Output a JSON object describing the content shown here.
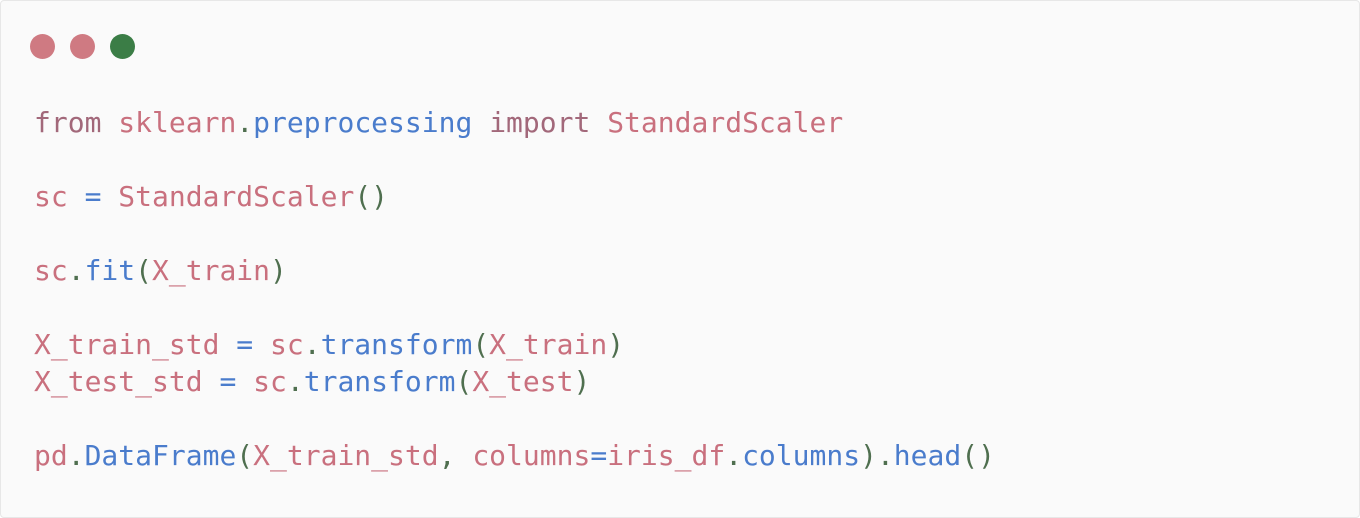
{
  "window": {
    "title_dots": [
      {
        "name": "close-dot",
        "color": "#cf7a82"
      },
      {
        "name": "minimize-dot",
        "color": "#cf7a82"
      },
      {
        "name": "maximize-dot",
        "color": "#3b7d46"
      }
    ]
  },
  "colors": {
    "keyword": "#a2687a",
    "identifier": "#c9707e",
    "attribute": "#4a7ccc",
    "punctuation": "#4f6f4f",
    "background": "#fafafa"
  },
  "code": {
    "lines": [
      [
        {
          "t": "from",
          "k": "kw"
        },
        {
          "t": " ",
          "k": "ws"
        },
        {
          "t": "sklearn",
          "k": "id"
        },
        {
          "t": ".",
          "k": "punc"
        },
        {
          "t": "preprocessing",
          "k": "attr"
        },
        {
          "t": " ",
          "k": "ws"
        },
        {
          "t": "import",
          "k": "kw"
        },
        {
          "t": " ",
          "k": "ws"
        },
        {
          "t": "StandardScaler",
          "k": "id"
        }
      ],
      [],
      [
        {
          "t": "sc",
          "k": "id"
        },
        {
          "t": " ",
          "k": "ws"
        },
        {
          "t": "=",
          "k": "op"
        },
        {
          "t": " ",
          "k": "ws"
        },
        {
          "t": "StandardScaler",
          "k": "id"
        },
        {
          "t": "()",
          "k": "punc"
        }
      ],
      [],
      [
        {
          "t": "sc",
          "k": "id"
        },
        {
          "t": ".",
          "k": "punc"
        },
        {
          "t": "fit",
          "k": "attr"
        },
        {
          "t": "(",
          "k": "punc"
        },
        {
          "t": "X_train",
          "k": "id"
        },
        {
          "t": ")",
          "k": "punc"
        }
      ],
      [],
      [
        {
          "t": "X_train_std",
          "k": "id"
        },
        {
          "t": " ",
          "k": "ws"
        },
        {
          "t": "=",
          "k": "op"
        },
        {
          "t": " ",
          "k": "ws"
        },
        {
          "t": "sc",
          "k": "id"
        },
        {
          "t": ".",
          "k": "punc"
        },
        {
          "t": "transform",
          "k": "attr"
        },
        {
          "t": "(",
          "k": "punc"
        },
        {
          "t": "X_train",
          "k": "id"
        },
        {
          "t": ")",
          "k": "punc"
        }
      ],
      [
        {
          "t": "X_test_std",
          "k": "id"
        },
        {
          "t": " ",
          "k": "ws"
        },
        {
          "t": "=",
          "k": "op"
        },
        {
          "t": " ",
          "k": "ws"
        },
        {
          "t": "sc",
          "k": "id"
        },
        {
          "t": ".",
          "k": "punc"
        },
        {
          "t": "transform",
          "k": "attr"
        },
        {
          "t": "(",
          "k": "punc"
        },
        {
          "t": "X_test",
          "k": "id"
        },
        {
          "t": ")",
          "k": "punc"
        }
      ],
      [],
      [
        {
          "t": "pd",
          "k": "id"
        },
        {
          "t": ".",
          "k": "punc"
        },
        {
          "t": "DataFrame",
          "k": "attr"
        },
        {
          "t": "(",
          "k": "punc"
        },
        {
          "t": "X_train_std",
          "k": "id"
        },
        {
          "t": ",",
          "k": "punc"
        },
        {
          "t": " ",
          "k": "ws"
        },
        {
          "t": "columns",
          "k": "id"
        },
        {
          "t": "=",
          "k": "op"
        },
        {
          "t": "iris_df",
          "k": "id"
        },
        {
          "t": ".",
          "k": "punc"
        },
        {
          "t": "columns",
          "k": "attr"
        },
        {
          "t": ")",
          "k": "punc"
        },
        {
          "t": ".",
          "k": "punc"
        },
        {
          "t": "head",
          "k": "attr"
        },
        {
          "t": "()",
          "k": "punc"
        }
      ]
    ]
  }
}
